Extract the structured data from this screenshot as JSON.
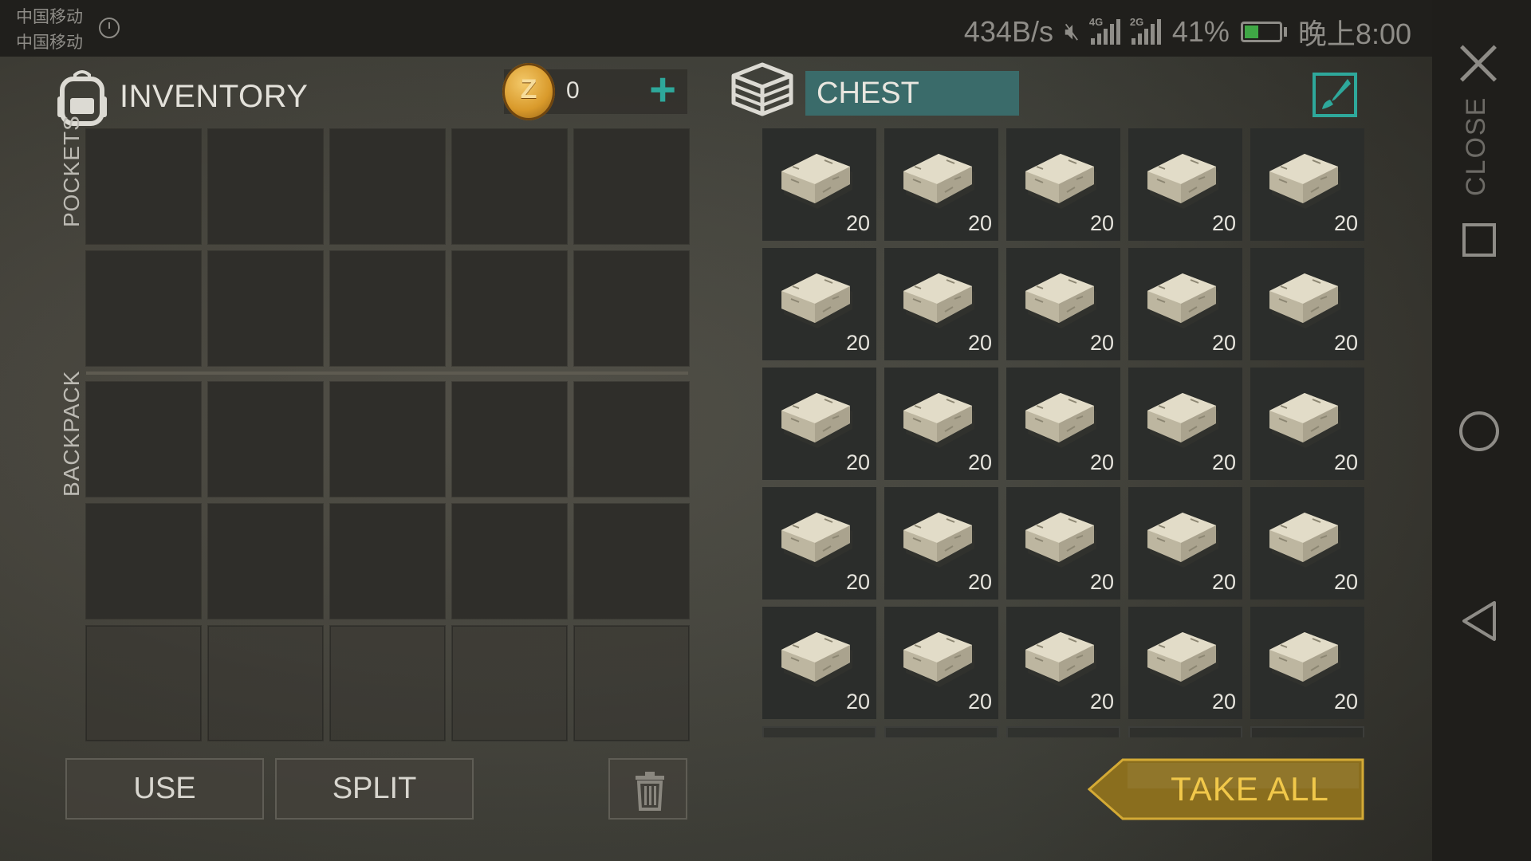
{
  "status_bar": {
    "carrier1": "中国移动",
    "carrier2": "中国移动",
    "net_speed": "434B/s",
    "sim1_tech": "4G",
    "sim2_tech": "2G",
    "battery_percent": "41%",
    "battery_level": 0.41,
    "time": "晚上8:00"
  },
  "inventory": {
    "title": "INVENTORY",
    "coins": "0",
    "coin_symbol": "Z",
    "add_symbol": "+",
    "pockets_label": "POCKETS",
    "backpack_label": "BACKPACK"
  },
  "chest": {
    "title": "CHEST",
    "item_name": "stone-block",
    "items": [
      "20",
      "20",
      "20",
      "20",
      "20",
      "20",
      "20",
      "20",
      "20",
      "20",
      "20",
      "20",
      "20",
      "20",
      "20",
      "20",
      "20",
      "20",
      "20",
      "20",
      "20",
      "20",
      "20",
      "20",
      "20"
    ]
  },
  "buttons": {
    "use": "USE",
    "split": "SPLIT",
    "take_all": "TAKE ALL"
  },
  "nav": {
    "close_label": "CLOSE"
  },
  "colors": {
    "accent_teal": "#2ea89b",
    "chest_title_bg": "#3a6b6a",
    "take_all_text": "#f1c84a",
    "take_all_bg": "#8a6e1e"
  }
}
